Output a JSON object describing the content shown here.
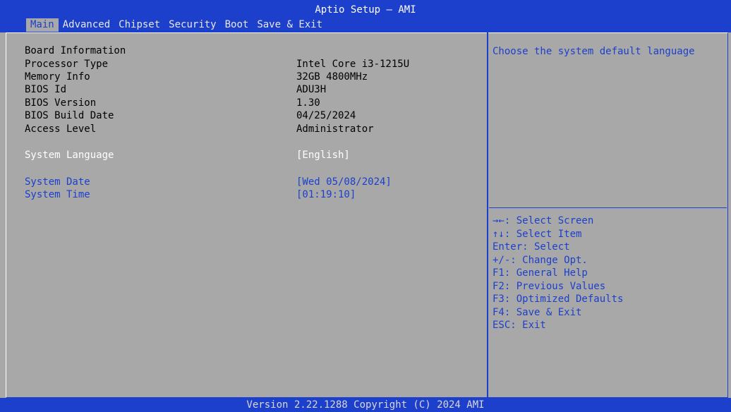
{
  "header": {
    "title": "Aptio Setup – AMI",
    "tabs": [
      "Main",
      "Advanced",
      "Chipset",
      "Security",
      "Boot",
      "Save & Exit"
    ],
    "active_tab": "Main"
  },
  "main": {
    "section_title": "Board Information",
    "info": [
      {
        "label": "Processor Type",
        "value": "Intel Core i3-1215U"
      },
      {
        "label": "Memory Info",
        "value": "32GB 4800MHz"
      },
      {
        "label": "BIOS Id",
        "value": "ADU3H"
      },
      {
        "label": "BIOS Version",
        "value": "1.30"
      },
      {
        "label": "BIOS Build Date",
        "value": "04/25/2024"
      },
      {
        "label": "Access Level",
        "value": "Administrator"
      }
    ],
    "language": {
      "label": "System Language",
      "value": "[English]"
    },
    "date": {
      "label": "System Date",
      "value": "[Wed 05/08/2024]"
    },
    "time": {
      "label": "System Time",
      "value": "[01:19:10]"
    }
  },
  "help": {
    "text": "Choose the system default language",
    "keys": [
      "→←: Select Screen",
      "↑↓: Select Item",
      "Enter: Select",
      "+/-: Change Opt.",
      "F1: General Help",
      "F2: Previous Values",
      "F3: Optimized Defaults",
      "F4: Save & Exit",
      "ESC: Exit"
    ]
  },
  "footer": {
    "text": "Version 2.22.1288 Copyright (C) 2024 AMI"
  },
  "colors": {
    "accent": "#1c3fcc",
    "background": "#a8a8a8",
    "highlight_text": "#ffffff"
  }
}
